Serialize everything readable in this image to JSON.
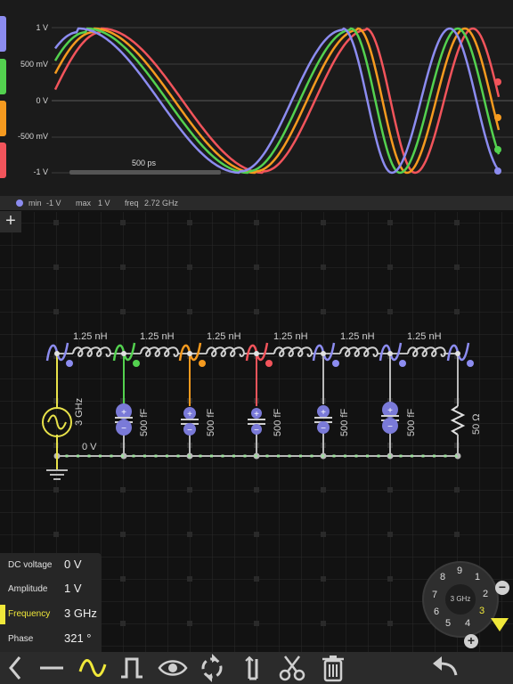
{
  "scope": {
    "y_labels": [
      "1 V",
      "500 mV",
      "0 V",
      "-500 mV",
      "-1 V"
    ],
    "time_label": "500 ps",
    "probe_colors": [
      "#8c8cf0",
      "#53d14f",
      "#f59a1f",
      "#f2545b"
    ]
  },
  "probe_info": {
    "min_label": "min",
    "min_value": "-1 V",
    "max_label": "max",
    "max_value": "1 V",
    "freq_label": "freq",
    "freq_value": "2.72 GHz"
  },
  "add_probe_label": "+",
  "circuit": {
    "inductor_label": "1.25 nH",
    "capacitor_label": "500 fF",
    "source_label": "3 GHz",
    "resistor_label": "50 Ω",
    "node_label": "0 V"
  },
  "params": [
    {
      "label": "DC voltage",
      "value": "0 V"
    },
    {
      "label": "Amplitude",
      "value": "1 V"
    },
    {
      "label": "Frequency",
      "value": "3 GHz"
    },
    {
      "label": "Phase",
      "value": "321 °"
    }
  ],
  "dial": {
    "center_label": "3 GHz",
    "digits": [
      "9",
      "8",
      "7",
      "6",
      "5",
      "4",
      "3",
      "2",
      "1"
    ],
    "active_digit": "3",
    "minus_label": "−",
    "plus_label": "+"
  },
  "accent_color": "#f0e83a",
  "toolbar": {
    "tools": [
      "back",
      "wire",
      "ac-source",
      "pulse",
      "probe",
      "rotate",
      "ground",
      "cut",
      "delete",
      "undo"
    ]
  }
}
